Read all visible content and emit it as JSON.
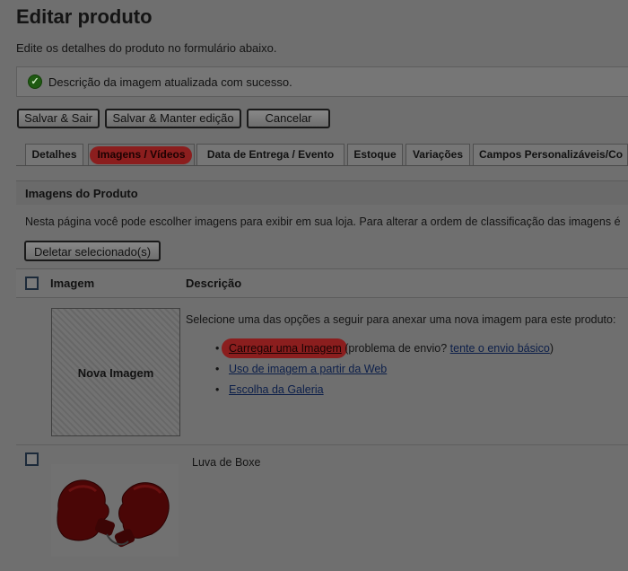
{
  "page": {
    "title": "Editar produto",
    "subtitle": "Edite os detalhes do produto no formulário abaixo."
  },
  "message": {
    "text": "Descrição da imagem atualizada com sucesso."
  },
  "actions": {
    "save_exit": "Salvar & Sair",
    "save_keep": "Salvar & Manter edição",
    "cancel": "Cancelar"
  },
  "tabs": [
    {
      "label": "Detalhes"
    },
    {
      "label": "Imagens / Vídeos",
      "active": true
    },
    {
      "label": "Data de Entrega / Evento"
    },
    {
      "label": "Estoque"
    },
    {
      "label": "Variações"
    },
    {
      "label": "Campos Personalizáveis/Co"
    }
  ],
  "section": {
    "title": "Imagens do Produto",
    "description": "Nesta página você pode escolher imagens para exibir em sua loja. Para alterar a ordem de classificação das imagens é",
    "delete_button": "Deletar selecionado(s)"
  },
  "table": {
    "col_image": "Imagem",
    "col_description": "Descrição"
  },
  "new_image": {
    "label": "Nova Imagem",
    "intro": "Selecione uma das opções a seguir para anexar uma nova imagem para este produto:",
    "bullet": "•",
    "upload_link": "Carregar uma Imagem",
    "upload_note_prefix": " (problema de envio? ",
    "basic_upload_link": "tente o envio básico",
    "upload_note_suffix": ")",
    "web_link": "Uso de imagem a partir da Web",
    "gallery_link": "Escolha da Galeria"
  },
  "product_row": {
    "name": "Luva de Boxe"
  },
  "colors": {
    "highlight": "#8e1515",
    "link": "#0c1f4a",
    "success": "#1f5a12"
  }
}
